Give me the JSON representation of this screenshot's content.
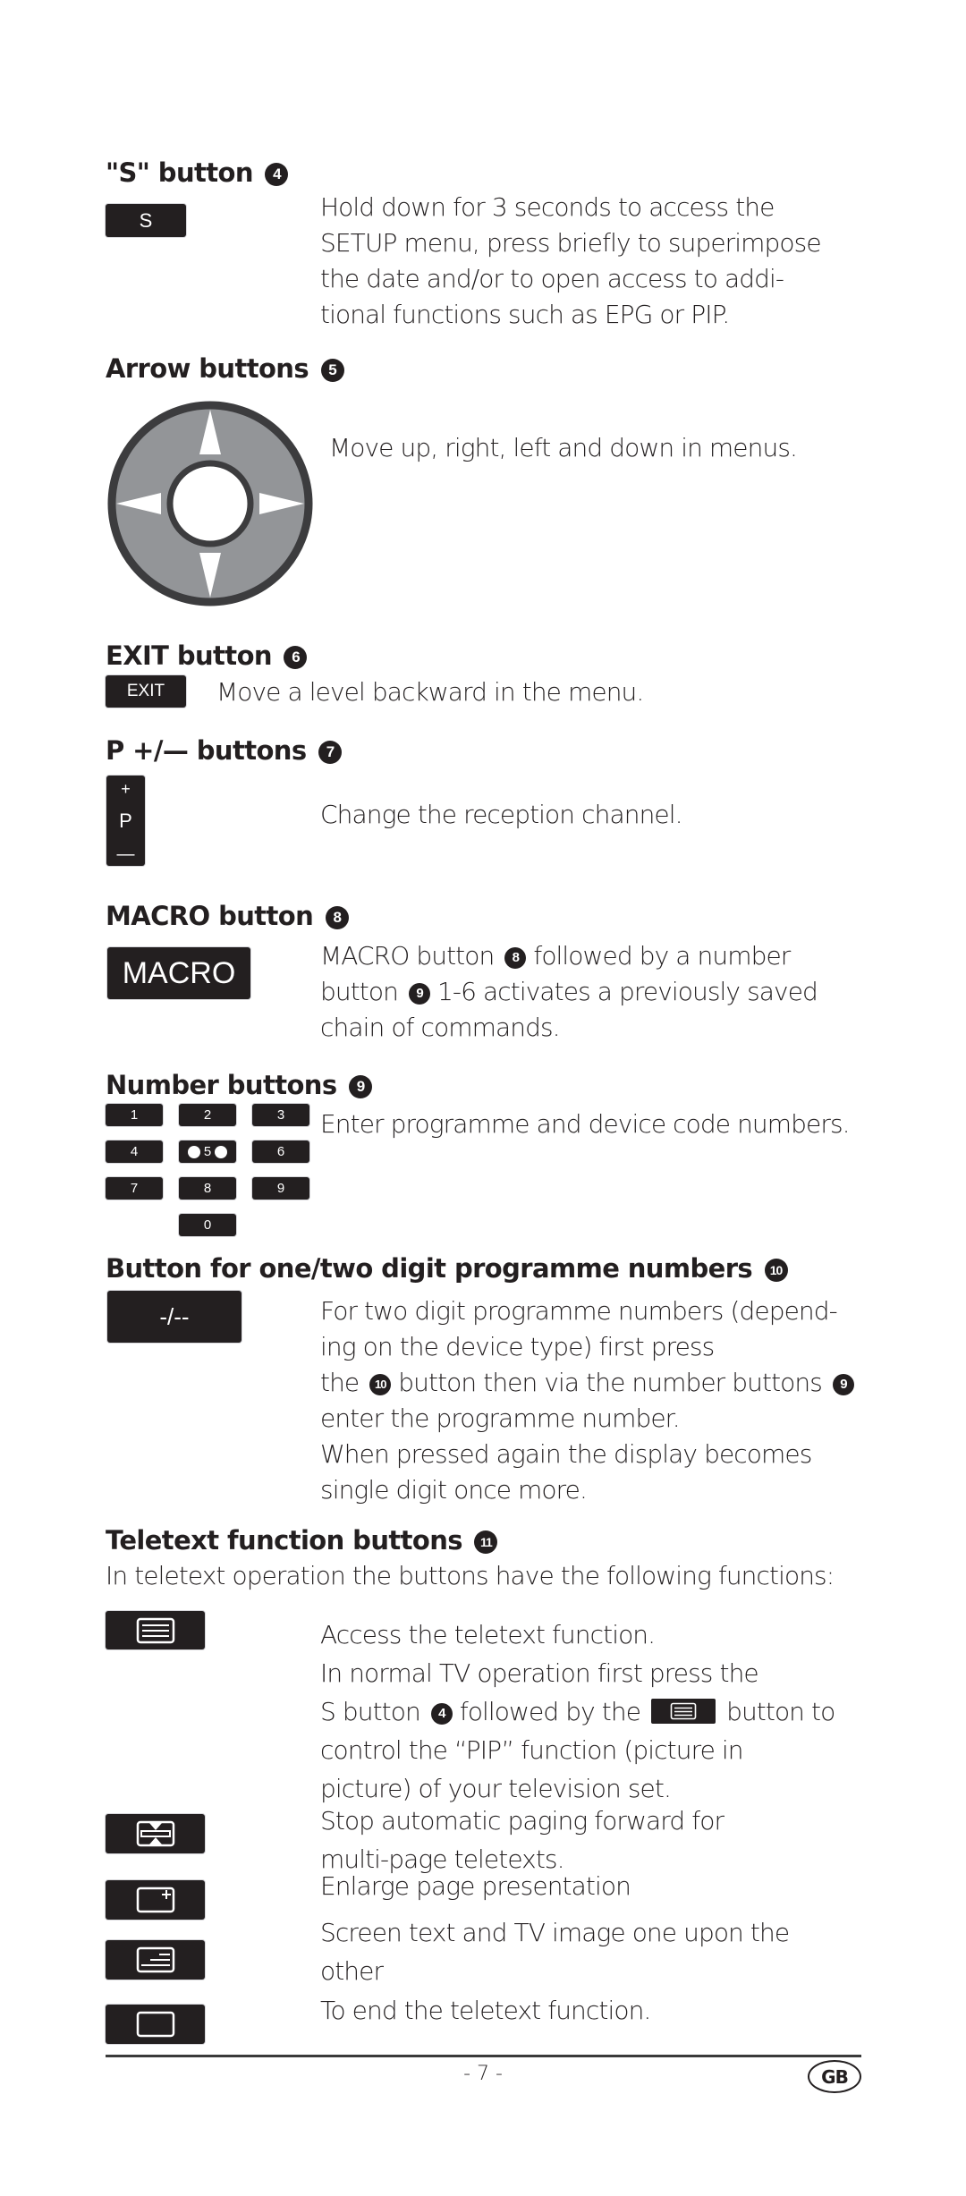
{
  "sections": {
    "s_button": {
      "heading": "\"S\" button",
      "ref": "4",
      "button_label": "S",
      "lines": [
        "Hold down for 3 seconds to access the",
        "SETUP menu, press briefly to superimpose",
        "the date and/or to open access to addi-",
        "tional functions such as EPG or PIP."
      ]
    },
    "arrow": {
      "heading": "Arrow buttons",
      "ref": "5",
      "text": "Move up, right, left and down in menus.",
      "colors": {
        "ring": "#3c3c3e",
        "pad": "#939598",
        "arrow": "#ffffff"
      }
    },
    "exit": {
      "heading": "EXIT button",
      "ref": "6",
      "button_label": "EXIT",
      "text": "Move a level backward in the menu."
    },
    "p_buttons": {
      "heading": "P +/— buttons",
      "ref": "7",
      "button_plus": "+",
      "button_p": "P",
      "button_minus": "—",
      "text": "Change the reception channel."
    },
    "macro": {
      "heading": "MACRO button",
      "ref": "8",
      "button_label": "MACRO",
      "line1_pre": "MACRO button",
      "line1_ref": "8",
      "line1_post": "followed by a number",
      "line2_pre": "button",
      "line2_ref": "9",
      "line2_post": "1-6 activates a previously saved",
      "line3": "chain of commands."
    },
    "number": {
      "heading": "Number buttons",
      "ref": "9",
      "keys": [
        "1",
        "2",
        "3",
        "4",
        "5",
        "6",
        "7",
        "8",
        "9",
        "0"
      ],
      "text": "Enter programme and device code numbers."
    },
    "digit": {
      "heading": "Button for one/two digit programme numbers",
      "ref": "10",
      "button_label": "-/--",
      "line1": "For two digit programme numbers (depend-",
      "line2": "ing on the device type) first press",
      "line3_pre": "the",
      "line3_ref": "10",
      "line3_mid": "button then via the number buttons",
      "line3_ref2": "9",
      "line4": "enter the programme number.",
      "line5": "When pressed again the display becomes",
      "line6": "single digit once more."
    },
    "teletext": {
      "heading": "Teletext function buttons",
      "ref": "11",
      "intro": "In teletext operation the buttons have the following functions:",
      "items": [
        {
          "icon": "teletext-icon",
          "line1": "Access the teletext function.",
          "line2": "In normal TV operation first press the",
          "line3_pre": "S button",
          "line3_ref": "4",
          "line3_mid": "followed by the",
          "line3_post": "button to",
          "line4": "control the “PIP” function (picture in",
          "line5": "picture) of your television set."
        },
        {
          "icon": "hold-icon",
          "line1": "Stop automatic paging forward for",
          "line2": "multi-page teletexts."
        },
        {
          "icon": "enlarge-icon",
          "line1": "Enlarge page presentation"
        },
        {
          "icon": "mix-icon",
          "line1": "Screen text and TV image one upon the",
          "line2": "other"
        },
        {
          "icon": "cancel-icon",
          "line1": "To end the teletext function."
        }
      ]
    }
  },
  "footer": {
    "page_number": "- 7 -",
    "country_badge": "GB"
  }
}
